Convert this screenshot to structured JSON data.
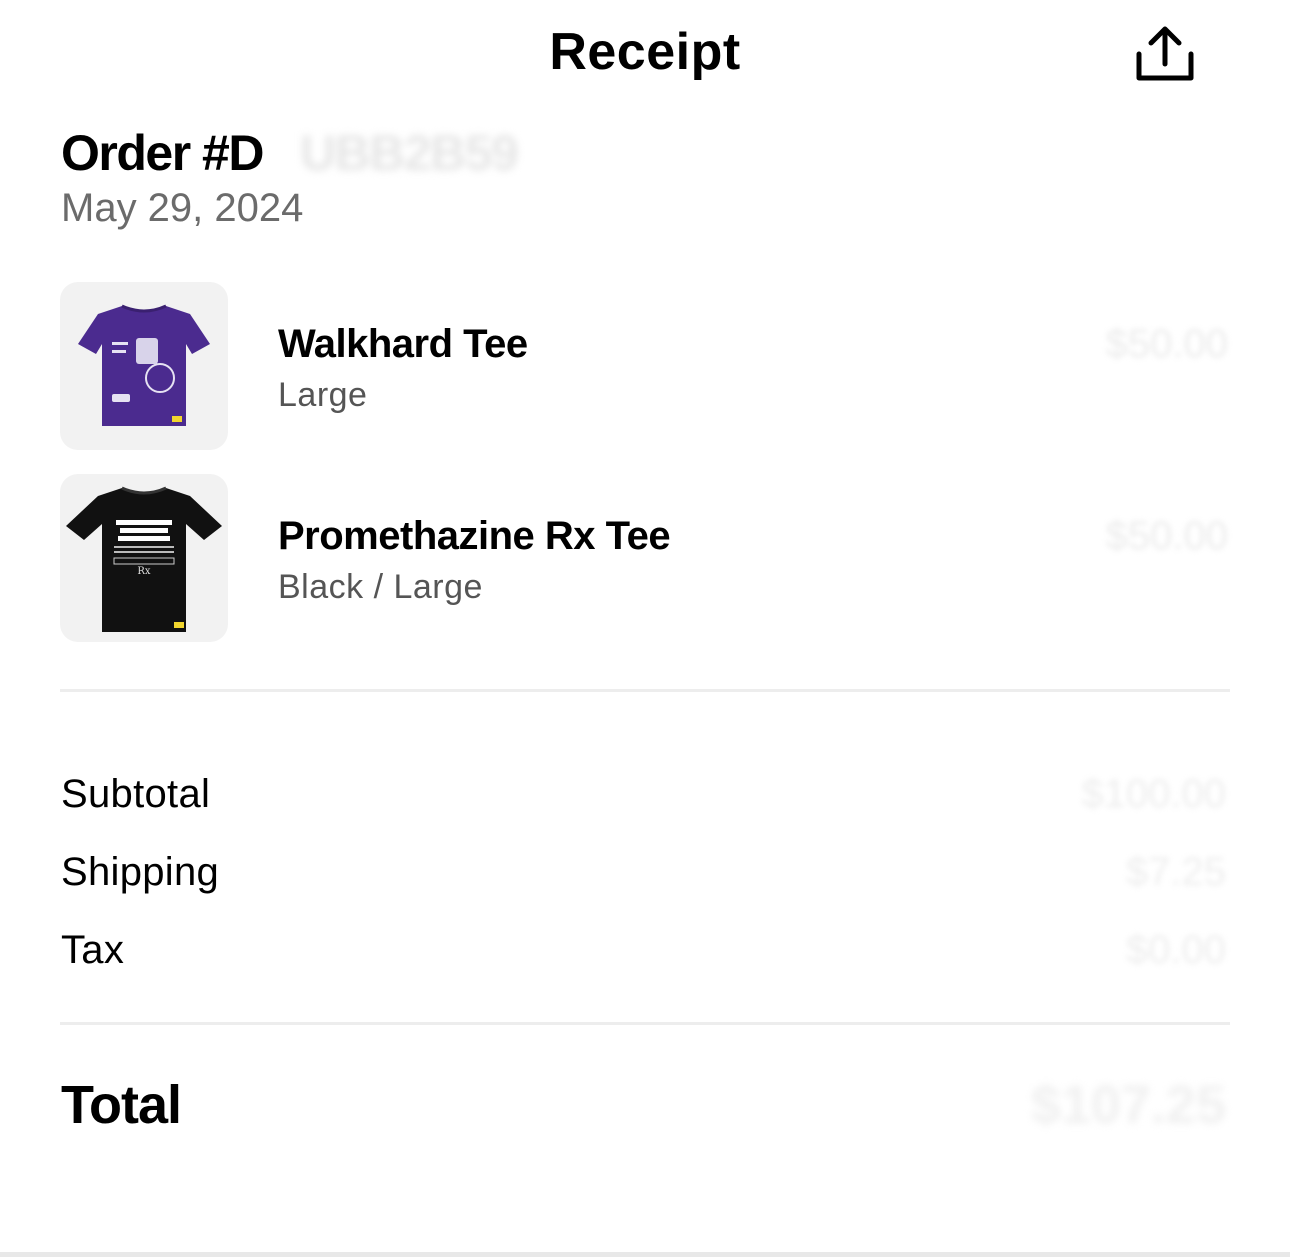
{
  "header": {
    "title": "Receipt",
    "share_icon": "share-icon"
  },
  "order": {
    "title": "Order #D",
    "number_hidden": "UBB2B59",
    "date": "May 29, 2024"
  },
  "items": [
    {
      "name": "Walkhard Tee",
      "variant": "Large",
      "price": "$50.00",
      "thumbnail": "purple-tshirt-image",
      "color": "#4b2b8f"
    },
    {
      "name": "Promethazine Rx Tee",
      "variant": "Black / Large",
      "price": "$50.00",
      "thumbnail": "black-tshirt-image",
      "color": "#111111"
    }
  ],
  "summary": {
    "subtotal_label": "Subtotal",
    "subtotal_value": "$100.00",
    "shipping_label": "Shipping",
    "shipping_value": "$7.25",
    "tax_label": "Tax",
    "tax_value": "$0.00",
    "total_label": "Total",
    "total_value": "$107.25"
  }
}
